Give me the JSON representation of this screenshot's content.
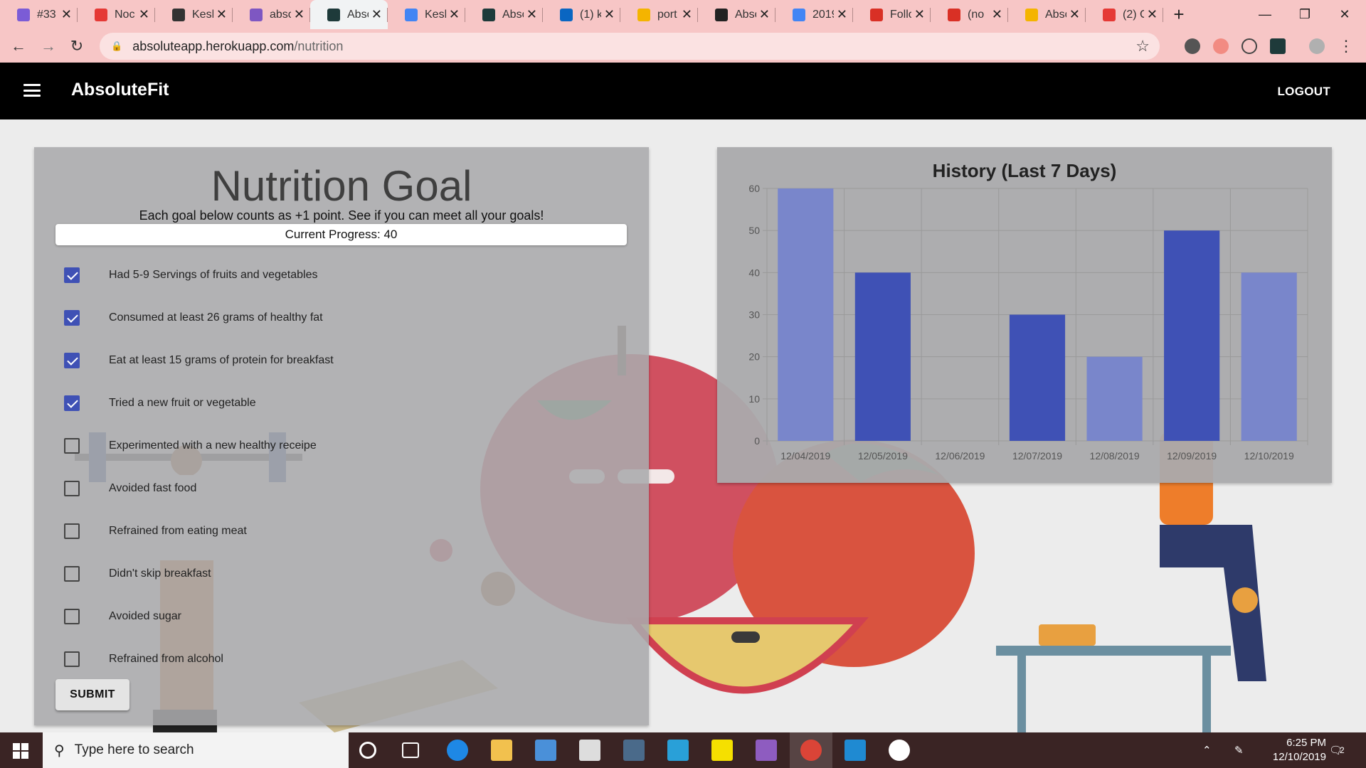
{
  "browser": {
    "tabs": [
      {
        "title": "#33",
        "favicon_color": "#7b5cd6"
      },
      {
        "title": "Noc",
        "favicon_color": "#e53935"
      },
      {
        "title": "Kesh",
        "favicon_color": "#333333"
      },
      {
        "title": "abso",
        "favicon_color": "#7e57c2"
      },
      {
        "title": "Abso",
        "favicon_color": "#1e3a3a"
      },
      {
        "title": "Kesh",
        "favicon_color": "#4285f4"
      },
      {
        "title": "Abso",
        "favicon_color": "#1e3a3a"
      },
      {
        "title": "(1) k",
        "favicon_color": "#0a66c2"
      },
      {
        "title": "port",
        "favicon_color": "#f4b400"
      },
      {
        "title": "Abso",
        "favicon_color": "#222222"
      },
      {
        "title": "2019",
        "favicon_color": "#4285f4"
      },
      {
        "title": "Follo",
        "favicon_color": "#d93025"
      },
      {
        "title": "(no",
        "favicon_color": "#d93025"
      },
      {
        "title": "Abso",
        "favicon_color": "#f4b400"
      },
      {
        "title": "(2) C",
        "favicon_color": "#e53935"
      }
    ],
    "active_tab_index": 4,
    "url_host": "absoluteapp.herokuapp.com",
    "url_path": "/nutrition"
  },
  "app": {
    "brand": "AbsoluteFit",
    "logout_label": "LOGOUT"
  },
  "nutrition": {
    "title": "Nutrition Goal",
    "subtitle": "Each goal below counts as +1 point. See if you can meet all your goals!",
    "progress_text": "Current Progress: 40",
    "goals": [
      {
        "label": "Had 5-9 Servings of fruits and vegetables",
        "checked": true
      },
      {
        "label": "Consumed at least 26 grams of healthy fat",
        "checked": true
      },
      {
        "label": "Eat at least 15 grams of protein for breakfast",
        "checked": true
      },
      {
        "label": "Tried a new fruit or vegetable",
        "checked": true
      },
      {
        "label": "Experimented with a new healthy receipe",
        "checked": false
      },
      {
        "label": "Avoided fast food",
        "checked": false
      },
      {
        "label": "Refrained from eating meat",
        "checked": false
      },
      {
        "label": "Didn't skip breakfast",
        "checked": false
      },
      {
        "label": "Avoided sugar",
        "checked": false
      },
      {
        "label": "Refrained from alcohol",
        "checked": false
      }
    ],
    "submit_label": "SUBMIT"
  },
  "history": {
    "title": "History (Last 7 Days)"
  },
  "chart_data": {
    "type": "bar",
    "title": "History (Last 7 Days)",
    "categories": [
      "12/04/2019",
      "12/05/2019",
      "12/06/2019",
      "12/07/2019",
      "12/08/2019",
      "12/09/2019",
      "12/10/2019"
    ],
    "values": [
      60,
      40,
      0,
      30,
      20,
      50,
      40
    ],
    "bar_colors": [
      "#7986cb",
      "#3f51b5",
      "#7986cb",
      "#3f51b5",
      "#7986cb",
      "#3f51b5",
      "#7986cb"
    ],
    "ylim": [
      0,
      60
    ],
    "yticks": [
      0,
      10,
      20,
      30,
      40,
      50,
      60
    ],
    "grid": true,
    "legend": "none"
  },
  "taskbar": {
    "search_placeholder": "Type here to search",
    "time": "6:25 PM",
    "date": "12/10/2019",
    "notification_count": "2"
  }
}
